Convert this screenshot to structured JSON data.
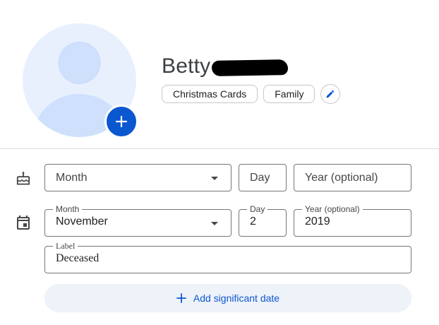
{
  "contact": {
    "first_name": "Betty",
    "labels": [
      "Christmas Cards",
      "Family"
    ]
  },
  "icons": {
    "avatar": "person-silhouette-icon",
    "add_photo": "plus-icon",
    "edit_labels": "pencil-icon",
    "birthday": "cake-icon",
    "event": "calendar-icon",
    "add": "plus-icon"
  },
  "colors": {
    "accent": "#0b57d0",
    "avatar_bg": "#e8f0fe",
    "avatar_figure": "#cfe0fc",
    "add_button_bg": "#eef2f9"
  },
  "birthday": {
    "month_placeholder": "Month",
    "day_placeholder": "Day",
    "year_placeholder": "Year (optional)"
  },
  "significant_date": {
    "month_label": "Month",
    "month_value": "November",
    "day_label": "Day",
    "day_value": "2",
    "year_label": "Year (optional)",
    "year_value": "2019",
    "label_label": "Label",
    "label_value": "Deceased"
  },
  "actions": {
    "add_significant_date": "Add significant date"
  }
}
